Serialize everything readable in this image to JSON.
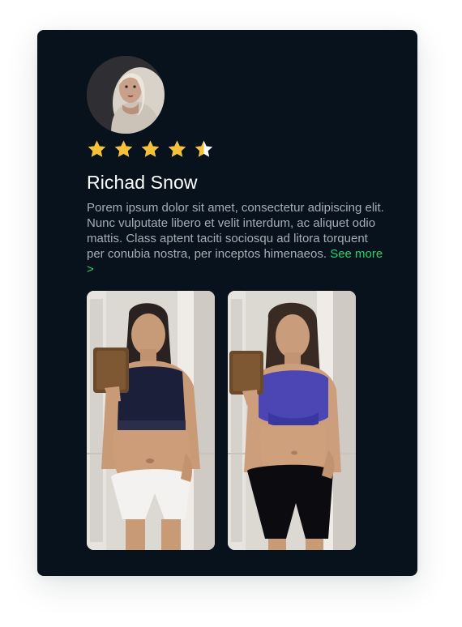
{
  "review": {
    "reviewer_name": "Richad Snow",
    "rating": 4.5,
    "rating_max": 5,
    "body": "Porem ipsum dolor sit amet, consectetur adipiscing elit. Nunc vulputate libero et velit interdum, ac aliquet odio mattis. Class aptent taciti sociosqu ad litora torquent per conubia nostra, per inceptos himenaeos.",
    "see_more_label": "See more >"
  },
  "colors": {
    "card_background": "#08121c",
    "star": "#f6c136",
    "link": "#27d36a",
    "name": "#ffffff",
    "body_text": "#a7adb5"
  },
  "icons": {
    "star": "star-icon",
    "star_half": "star-half-icon"
  }
}
